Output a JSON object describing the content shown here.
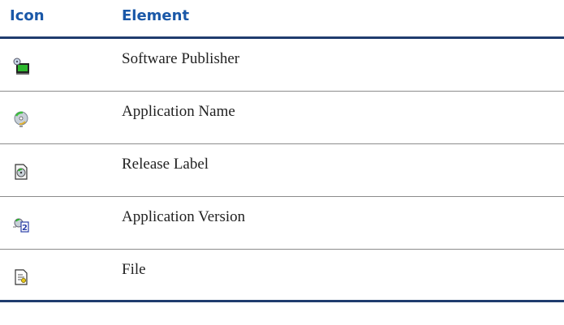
{
  "table": {
    "headers": {
      "icon": "Icon",
      "element": "Element"
    },
    "rows": [
      {
        "icon": "software-publisher-icon",
        "label": "Software Publisher"
      },
      {
        "icon": "application-name-icon",
        "label": "Application Name"
      },
      {
        "icon": "release-label-icon",
        "label": "Release Label"
      },
      {
        "icon": "application-version-icon",
        "label": "Application Version"
      },
      {
        "icon": "file-icon",
        "label": "File"
      }
    ]
  }
}
